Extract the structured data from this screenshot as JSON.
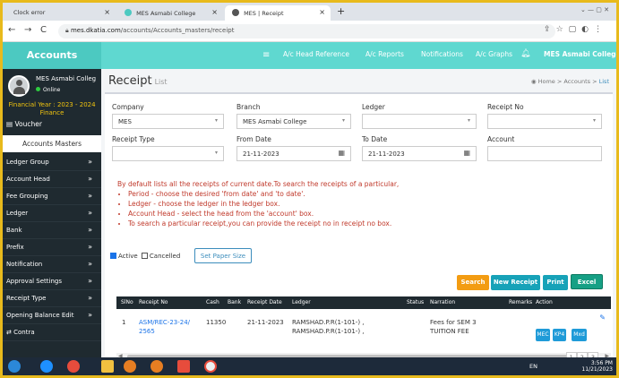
{
  "browser": {
    "tabs": [
      {
        "title": "Clock error"
      },
      {
        "title": "MES Asmabi College"
      },
      {
        "title": "MES | Receipt"
      }
    ],
    "url_host": "mes.dkatia.com",
    "url_path": "/accounts/Accounts_masters/receipt"
  },
  "header": {
    "brand": "Accounts",
    "nav": [
      "A/c Head Reference",
      "A/c Reports",
      "Notifications",
      "A/c Graphs"
    ],
    "college": "MES Asmabi College"
  },
  "sidebar": {
    "profile_name": "MES Asmabi Colleg",
    "status": "Online",
    "financial_year": "Financial Year : 2023 - 2024",
    "module": "Finance",
    "voucher": "Voucher",
    "masters": "Accounts Masters",
    "items": [
      {
        "label": "Ledger Group"
      },
      {
        "label": "Account Head"
      },
      {
        "label": "Fee Grouping"
      },
      {
        "label": "Ledger"
      },
      {
        "label": "Bank"
      },
      {
        "label": "Prefix"
      },
      {
        "label": "Notification"
      },
      {
        "label": "Approval Settings"
      },
      {
        "label": "Receipt Type"
      },
      {
        "label": "Opening Balance Edit"
      },
      {
        "label": "Contra"
      }
    ]
  },
  "page": {
    "title": "Receipt",
    "subtitle": "List",
    "breadcrumb": {
      "home": "Home",
      "section": "Accounts",
      "current": "List"
    }
  },
  "filters": {
    "company_label": "Company",
    "company_value": "MES",
    "branch_label": "Branch",
    "branch_value": "MES Asmabi College",
    "ledger_label": "Ledger",
    "ledger_value": "",
    "receipt_no_label": "Receipt No",
    "receipt_no_value": "",
    "receipt_type_label": "Receipt Type",
    "receipt_type_value": "",
    "from_date_label": "From Date",
    "from_date_value": "21-11-2023",
    "to_date_label": "To Date",
    "to_date_value": "21-11-2023",
    "account_label": "Account",
    "account_value": ""
  },
  "info": {
    "intro": "By default lists all the receipts of current date.To search the receipts of a particular,",
    "bullets": [
      "Period - choose the desired 'from date' and 'to date'.",
      "Ledger - choose the ledger in the ledger box.",
      "Account Head - select the head from the 'account' box.",
      "To search a particular receipt,you can provide the receipt no in receipt no box."
    ]
  },
  "options": {
    "active": "Active",
    "cancelled": "Cancelled",
    "set_paper_size": "Set Paper Size"
  },
  "actions": {
    "search": "Search",
    "new_receipt": "New Receipt",
    "print": "Print",
    "excel": "Excel"
  },
  "table": {
    "columns": [
      "SlNo",
      "Receipt No",
      "Cash",
      "Bank",
      "Receipt Date",
      "Ledger",
      "Status",
      "Narration",
      "Remarks",
      "Action"
    ],
    "rows": [
      {
        "slno": "1",
        "receipt_no_1": "ASM/REC-23-24/",
        "receipt_no_2": "2565",
        "cash": "11350",
        "bank": "",
        "date": "21-11-2023",
        "ledger_1": "RAMSHAD.P.R(1-101-) ,",
        "ledger_2": "RAMSHAD.P.R(1-101-) ,",
        "status": "",
        "narration_1": "Fees for SEM 3",
        "narration_2": "TUITION FEE",
        "remarks": "",
        "action_buttons": [
          "MEC",
          "KP4",
          "Mxd"
        ]
      }
    ]
  },
  "pagination": {
    "pages": [
      "1",
      "2",
      "3"
    ]
  },
  "taskbar": {
    "lang": "EN",
    "time": "3:56 PM",
    "date": "11/21/2023"
  }
}
